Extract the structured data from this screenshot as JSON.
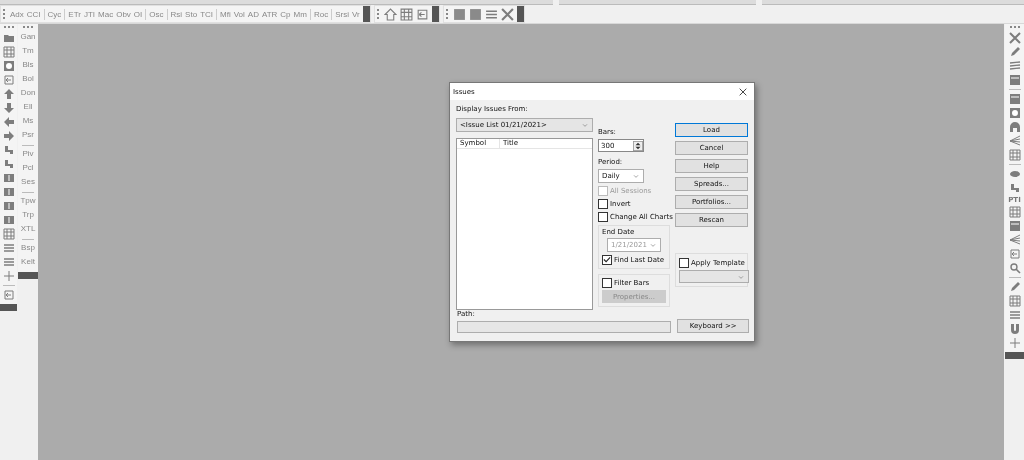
{
  "indicator_toolbar": {
    "groups": [
      [
        "Adx",
        "CCI"
      ],
      [
        "Cyc"
      ],
      [
        "ETr",
        "JTI",
        "Mac",
        "Obv",
        "OI"
      ],
      [
        "Osc"
      ],
      [
        "Rsi",
        "Sto",
        "TCI"
      ],
      [
        "Mfi",
        "Vol",
        "AD",
        "ATR",
        "Cp",
        "Mm"
      ],
      [
        "Roc"
      ],
      [
        "Srsi",
        "Vr"
      ]
    ]
  },
  "study_toolbar": {
    "groups": [
      [
        "Gan",
        "Tm",
        "Bls",
        "Bol",
        "Don",
        "Ell",
        "Ms",
        "Psr"
      ],
      [
        "Piv",
        "Pcl",
        "Ses"
      ],
      [
        "Tpw",
        "Trp",
        "XTL"
      ],
      [
        "Bsp",
        "Kelt"
      ]
    ]
  },
  "right_toolbar": {
    "label": "PTI"
  },
  "dialog": {
    "title": "Issues",
    "source_label": "Display Issues From:",
    "source_value": "<Issue List 01/21/2021>",
    "columns": [
      "Symbol",
      "Title"
    ],
    "bars_label": "Bars:",
    "bars_value": "300",
    "period_label": "Period:",
    "period_value": "Daily",
    "options": [
      {
        "label": "All Sessions",
        "checked": false,
        "disabled": true
      },
      {
        "label": "Invert",
        "checked": false,
        "disabled": false
      },
      {
        "label": "Change All Charts",
        "checked": false,
        "disabled": false
      }
    ],
    "end_date": {
      "title": "End Date",
      "value": "1/21/2021",
      "find_last": {
        "label": "Find Last Date",
        "checked": true
      }
    },
    "filter": {
      "label": "Filter Bars",
      "checked": false,
      "button": "Properties..."
    },
    "template": {
      "label": "Apply Template",
      "checked": false
    },
    "buttons": [
      {
        "label": "Load",
        "default": true
      },
      {
        "label": "Cancel",
        "default": false
      },
      {
        "label": "Help",
        "default": false
      },
      {
        "label": "Spreads...",
        "default": false
      },
      {
        "label": "Portfolios...",
        "default": false
      },
      {
        "label": "Rescan",
        "default": false
      }
    ],
    "path_label": "Path:",
    "keyboard_button": "Keyboard >>"
  }
}
